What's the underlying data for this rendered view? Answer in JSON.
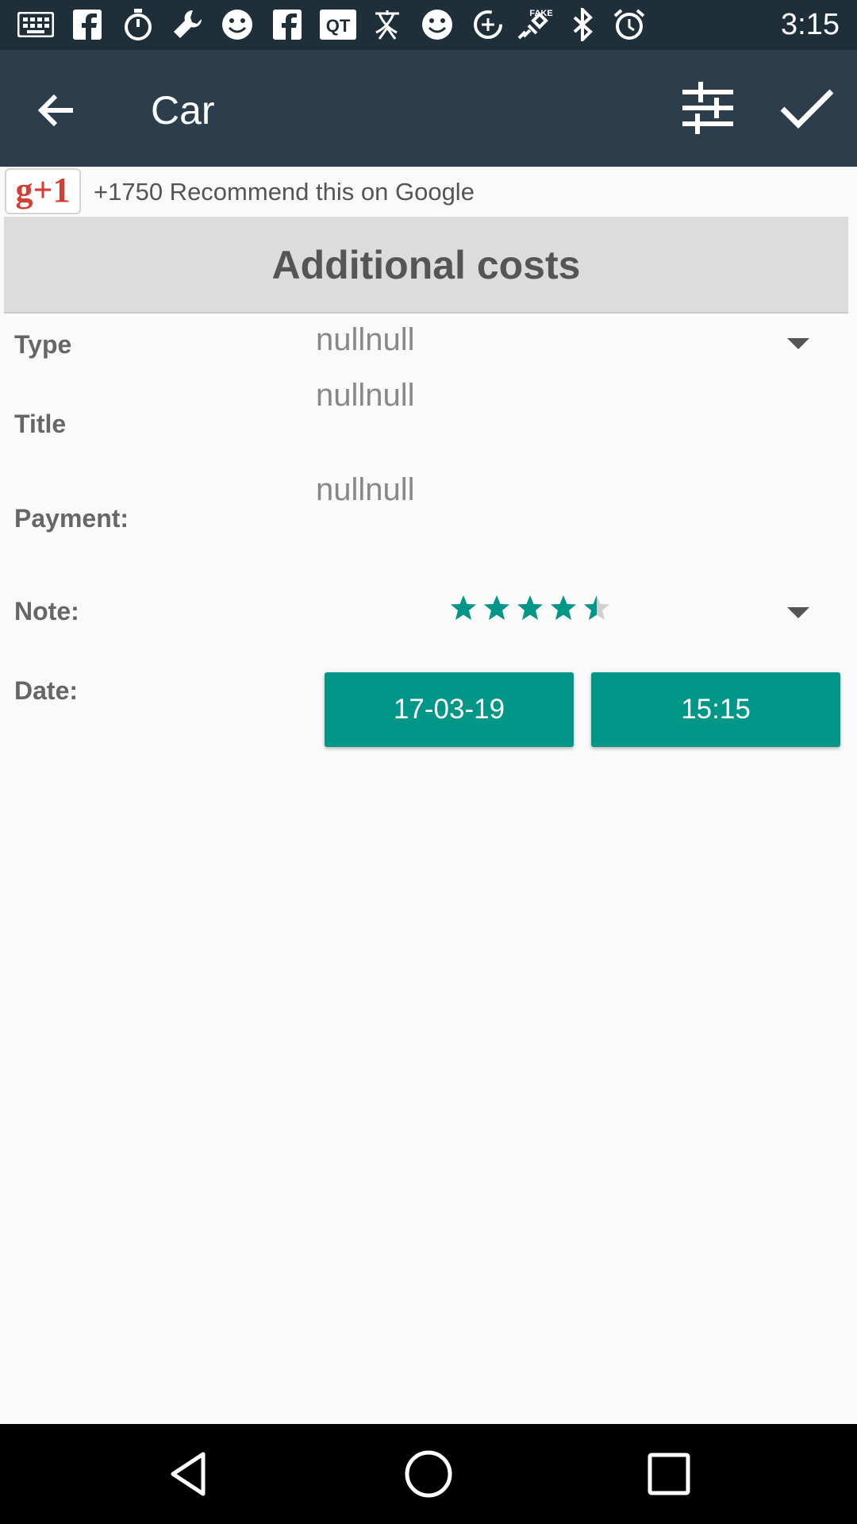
{
  "status_bar": {
    "time": "3:15",
    "notification_icons": [
      "grid-app-icon",
      "facebook-icon",
      "stopwatch-icon",
      "wrench-icon",
      "smiley-icon",
      "facebook-icon",
      "qq-icon",
      "translate-icon",
      "smiley-icon",
      "data-saver-icon",
      "satellite-fake-gps-icon",
      "bluetooth-icon",
      "alarm-icon"
    ]
  },
  "app_bar": {
    "title": "Car",
    "icons": [
      "back-arrow-icon",
      "tune-sliders-icon",
      "check-icon"
    ]
  },
  "google_plus": {
    "button_label": "g+1",
    "text": "+1750 Recommend this on Google"
  },
  "section": {
    "header": "Additional costs"
  },
  "form": {
    "type_label": "Type",
    "type_value": "nullnull",
    "title_label": "Title",
    "title_value": "nullnull",
    "payment_label": "Payment:",
    "payment_value": "nullnull",
    "note_label": "Note:",
    "note_rating": 4.5,
    "note_rating_max": 5,
    "date_label": "Date:",
    "date_value": "17-03-19",
    "time_value": "15:15"
  },
  "nav_bar": {
    "icons": [
      "back-triangle-icon",
      "home-circle-icon",
      "recents-square-icon"
    ]
  },
  "colors": {
    "status_bar": "#1f2f3a",
    "app_bar": "#2c3e4c",
    "accent": "#009688",
    "header_bg": "#dcdcdc",
    "background": "#fafafa"
  }
}
